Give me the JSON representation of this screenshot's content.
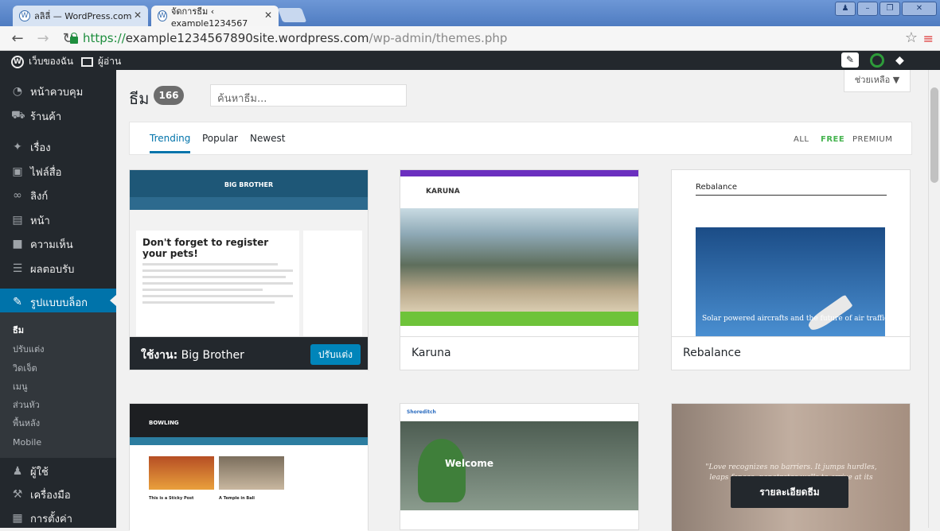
{
  "browser": {
    "tabs": [
      {
        "title": "ลลิลี่ — WordPress.com"
      },
      {
        "title": "จัดการธีม ‹ example1234567"
      }
    ],
    "url": {
      "scheme": "https://",
      "host": "example1234567890site.wordpress.com",
      "path": "/wp-admin/themes.php"
    }
  },
  "admin_bar": {
    "my_site": "เว็บของฉัน",
    "reader": "ผู้อ่าน"
  },
  "sidebar": {
    "items": [
      {
        "label": "หน้าควบคุม",
        "icon": "dashboard-icon"
      },
      {
        "label": "ร้านค้า",
        "icon": "cart-icon"
      },
      {
        "label": "เรื่อง",
        "icon": "pin-icon"
      },
      {
        "label": "ไฟล์สื่อ",
        "icon": "media-icon"
      },
      {
        "label": "ลิงก์",
        "icon": "link-icon"
      },
      {
        "label": "หน้า",
        "icon": "page-icon"
      },
      {
        "label": "ความเห็น",
        "icon": "comment-icon"
      },
      {
        "label": "ผลตอบรับ",
        "icon": "feedback-icon"
      },
      {
        "label": "รูปแบบบล็อก",
        "icon": "brush-icon"
      },
      {
        "label": "ผู้ใช้",
        "icon": "user-icon"
      },
      {
        "label": "เครื่องมือ",
        "icon": "wrench-icon"
      },
      {
        "label": "การตั้งค่า",
        "icon": "settings-icon"
      }
    ],
    "submenu": [
      "ธีม",
      "ปรับแต่ง",
      "วิดเจ็ต",
      "เมนู",
      "ส่วนหัว",
      "พื้นหลัง",
      "Mobile"
    ]
  },
  "main": {
    "title": "ธีม",
    "count": "166",
    "search_placeholder": "ค้นหาธีม...",
    "help": "ช่วยเหลือ ▼",
    "tabs": [
      "Trending",
      "Popular",
      "Newest"
    ],
    "filters": [
      "ALL",
      "FREE",
      "PREMIUM"
    ],
    "themes": [
      {
        "active_prefix": "ใช้งาน:",
        "name": "Big Brother",
        "button": "ปรับแต่ง",
        "preview_title": "BIG BROTHER",
        "preview_post": "Don't forget to register your pets!"
      },
      {
        "name": "Karuna",
        "preview_logo": "KARUNA"
      },
      {
        "name": "Rebalance",
        "preview_logo": "Rebalance",
        "preview_caption": "Solar powered aircrafts and the future of air traffic"
      },
      {
        "preview_logo": "BOWLING",
        "preview_post1": "This is a Sticky Post",
        "preview_post2": "A Temple in Bali"
      },
      {
        "preview_logo": "Shoreditch",
        "preview_heading": "Welcome"
      },
      {
        "preview_quote": "\"Love recognizes no barriers. It jumps hurdles, leaps fences, penetrates walls to arrive at its destination full of hope.\"",
        "details_button": "รายละเอียดธีม"
      }
    ]
  }
}
